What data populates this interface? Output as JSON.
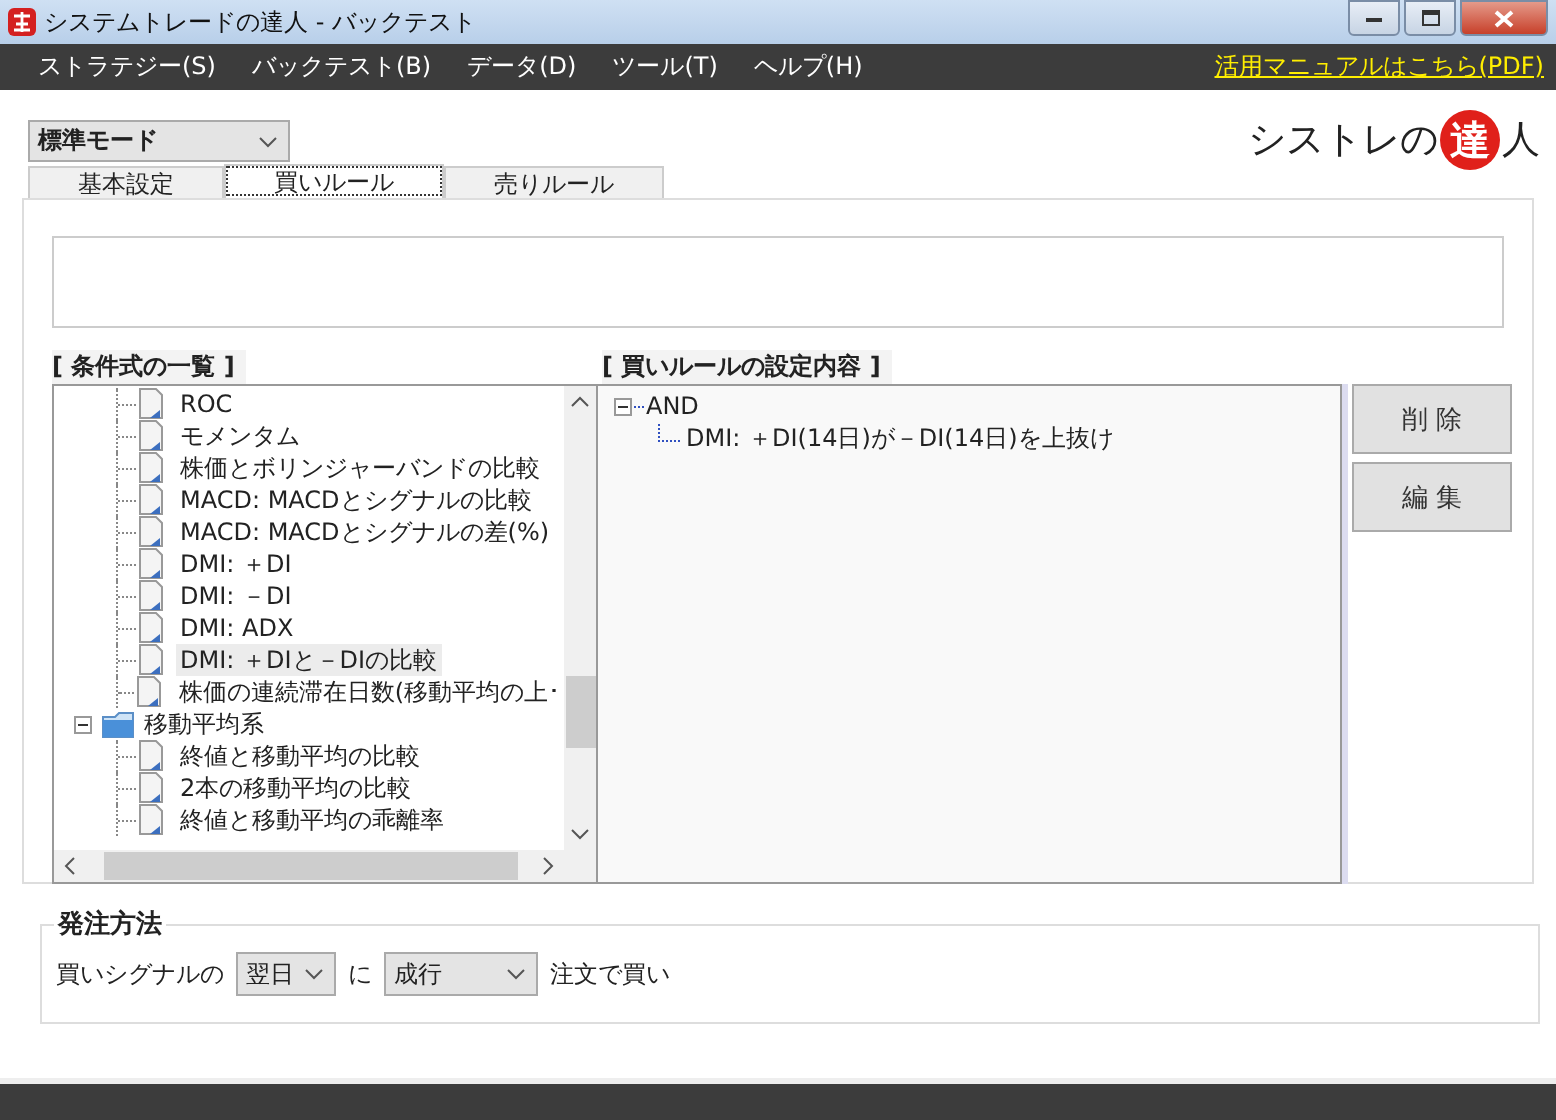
{
  "window": {
    "title": "システムトレードの達人 - バックテスト"
  },
  "menu": [
    {
      "label": "ストラテジー(S)"
    },
    {
      "label": "バックテスト(B)"
    },
    {
      "label": "データ(D)"
    },
    {
      "label": "ツール(T)"
    },
    {
      "label": "ヘルプ(H)"
    }
  ],
  "manual_link": "活用マニュアルはこちら(PDF)",
  "mode_select": {
    "value": "標準モード"
  },
  "logo": {
    "before": "シストレの",
    "emblem": "達",
    "after": "人"
  },
  "tabs": [
    {
      "label": "基本設定",
      "selected": false
    },
    {
      "label": "買いルール",
      "selected": true
    },
    {
      "label": "売りルール",
      "selected": false
    }
  ],
  "condition_list": {
    "title": "[ 条件式の一覧 ]",
    "items": [
      {
        "children": [
          {
            "label": "ROC",
            "selected": false
          },
          {
            "label": "モメンタム",
            "selected": false
          },
          {
            "label": "株価とボリンジャーバンドの比較",
            "selected": false
          },
          {
            "label": "MACD: MACDとシグナルの比較",
            "selected": false
          },
          {
            "label": "MACD: MACDとシグナルの差(%)",
            "selected": false
          },
          {
            "label": "DMI: ＋DI",
            "selected": false
          },
          {
            "label": "DMI: －DI",
            "selected": false
          },
          {
            "label": "DMI: ADX",
            "selected": false
          },
          {
            "label": "DMI: ＋DIと－DIの比較",
            "selected": true
          },
          {
            "label": "株価の連続滞在日数(移動平均の上･",
            "selected": false
          }
        ]
      },
      {
        "label": "移動平均系",
        "expanded": true,
        "children": [
          {
            "label": "終値と移動平均の比較",
            "selected": false
          },
          {
            "label": "2本の移動平均の比較",
            "selected": false
          },
          {
            "label": "終値と移動平均の乖離率",
            "selected": false
          }
        ]
      }
    ]
  },
  "rule_settings": {
    "title": "[ 買いルールの設定内容 ]",
    "root": {
      "label": "AND",
      "expanded": true,
      "children": [
        {
          "label": "DMI: ＋DI(14日)が－DI(14日)を上抜け"
        }
      ]
    }
  },
  "buttons": [
    {
      "label": "削 除"
    },
    {
      "label": "編 集"
    }
  ],
  "order_method": {
    "title": "発注方法",
    "prefix": "買いシグナルの",
    "timing": "翌日",
    "middle": "に",
    "type": "成行",
    "suffix": "注文で買い"
  }
}
